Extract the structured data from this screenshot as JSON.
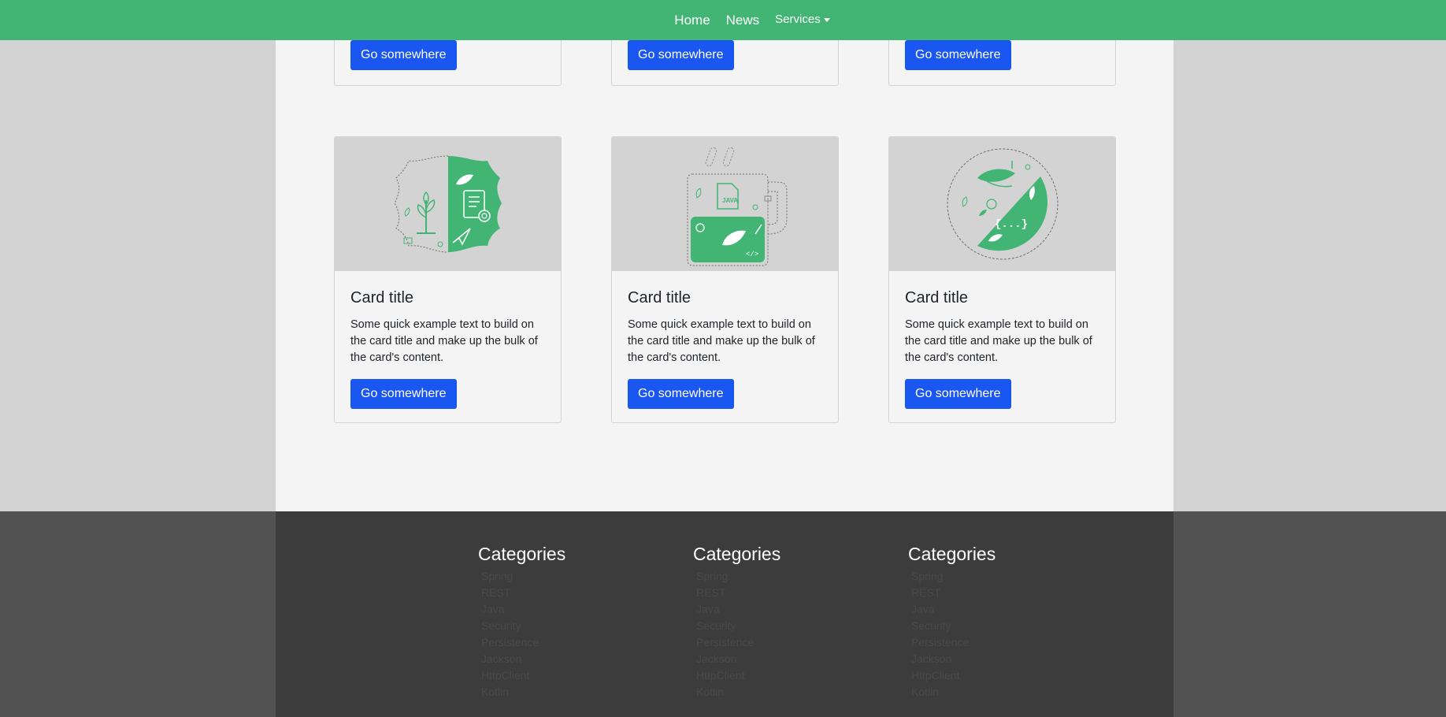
{
  "nav": {
    "home": "Home",
    "news": "News",
    "services": "Services"
  },
  "colors": {
    "brand_green": "#42b574",
    "button_blue": "#1a56f0",
    "footer_dark": "#3c3c3c"
  },
  "top_row": {
    "buttons": [
      "Go somewhere",
      "Go somewhere",
      "Go somewhere"
    ]
  },
  "cards": [
    {
      "image_icon": "spring-badge-illustration",
      "title": "Card title",
      "text": "Some quick example text to build on the card title and make up the bulk of the card's content.",
      "button": "Go somewhere"
    },
    {
      "image_icon": "java-mug-illustration",
      "title": "Card title",
      "text": "Some quick example text to build on the card title and make up the bulk of the card's content.",
      "button": "Go somewhere"
    },
    {
      "image_icon": "leaf-circle-illustration",
      "title": "Card title",
      "text": "Some quick example text to build on the card title and make up the bulk of the card's content.",
      "button": "Go somewhere"
    }
  ],
  "footer": {
    "columns": [
      {
        "heading": "Categories",
        "items": [
          "Spring",
          "REST",
          "Java",
          "Security",
          "Persistence",
          "Jackson",
          "HttpClient",
          "Kotlin"
        ]
      },
      {
        "heading": "Categories",
        "items": [
          "Spring",
          "REST",
          "Java",
          "Security",
          "Persistence",
          "Jackson",
          "HttpClient",
          "Kotlin"
        ]
      },
      {
        "heading": "Categories",
        "items": [
          "Spring",
          "REST",
          "Java",
          "Security",
          "Persistence",
          "Jackson",
          "HttpClient",
          "Kotlin"
        ]
      }
    ]
  }
}
